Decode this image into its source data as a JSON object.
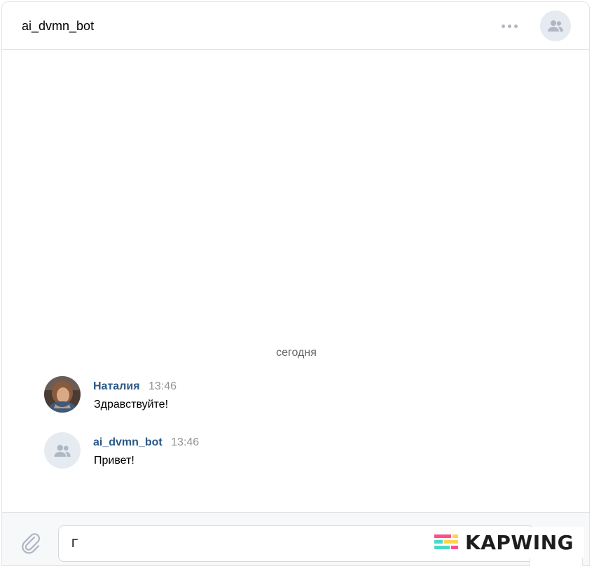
{
  "header": {
    "title": "ai_dvmn_bot",
    "more_icon": "more-horizontal-icon",
    "avatar_icon": "users-icon"
  },
  "chat": {
    "date_separator": "сегодня",
    "messages": [
      {
        "author": "Наталия",
        "time": "13:46",
        "text": "Здравствуйте!",
        "avatar": "user-photo"
      },
      {
        "author": "ai_dvmn_bot",
        "time": "13:46",
        "text": "Привет!",
        "avatar": "users-icon"
      }
    ]
  },
  "composer": {
    "input_value": "Г",
    "attach_icon": "paperclip-icon",
    "emoji_icon": "smile-icon",
    "send_icon": "send-icon"
  },
  "watermark": {
    "text": "KAPWING"
  },
  "colors": {
    "author_link": "#2a5885",
    "accent": "#5181b8",
    "icon_gray": "#aeb7c2",
    "avatar_bg": "#e5ebf1"
  }
}
